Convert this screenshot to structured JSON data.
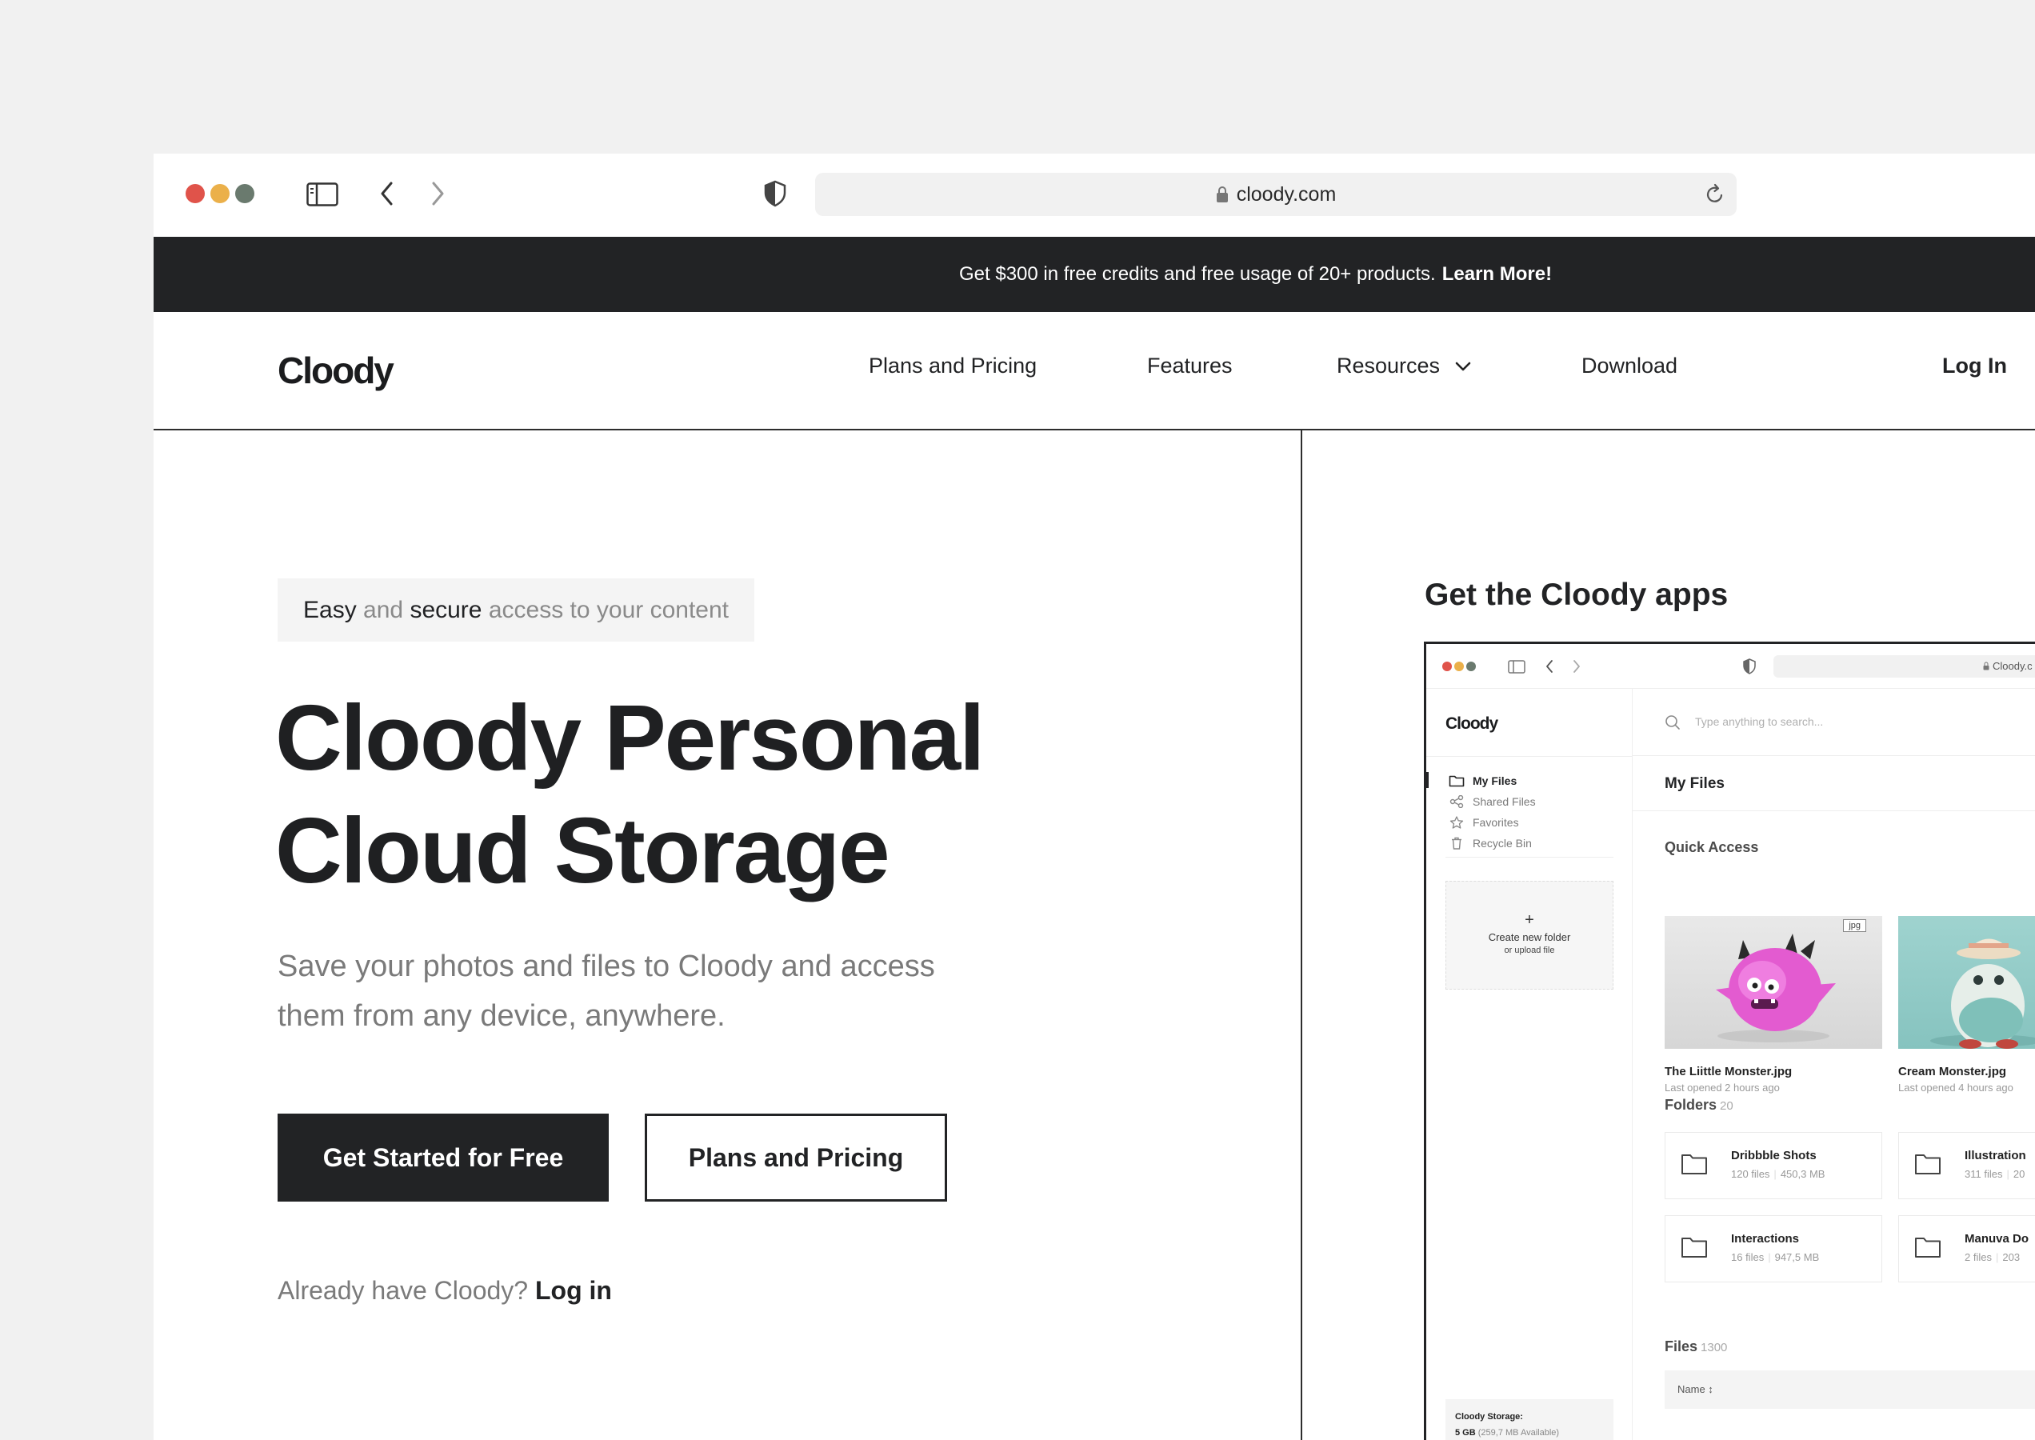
{
  "browser": {
    "url": "cloody.com",
    "traffic_lights": {
      "close": "#e0534a",
      "minimize": "#ebb04a",
      "maximize": "#6a7a6e"
    }
  },
  "promo": {
    "text": "Get $300 in free credits and free usage of 20+ products.",
    "link": "Learn More!"
  },
  "nav": {
    "logo": "Cloody",
    "items": [
      "Plans and Pricing",
      "Features",
      "Resources",
      "Download"
    ],
    "login": "Log In"
  },
  "hero": {
    "tagline": [
      "Easy",
      " and ",
      "secure",
      " access to your content"
    ],
    "title_line1": "Cloody Personal",
    "title_line2": "Cloud Storage",
    "subtitle_line1": "Save your photos and files to Cloody and access",
    "subtitle_line2": "them from any device, anywhere.",
    "primary_button": "Get Started for Free",
    "secondary_button": "Plans and Pricing",
    "already_text": "Already have Cloody?",
    "login_link": "Log in"
  },
  "apps": {
    "title": "Get the Cloody apps",
    "mock": {
      "url": "Cloody.c",
      "logo": "Cloody",
      "search_placeholder": "Type anything to search...",
      "sidebar": [
        {
          "label": "My Files",
          "icon": "folder-icon"
        },
        {
          "label": "Shared Files",
          "icon": "share-icon"
        },
        {
          "label": "Favorites",
          "icon": "star-icon"
        },
        {
          "label": "Recycle Bin",
          "icon": "trash-icon"
        }
      ],
      "create_title": "Create new folder",
      "create_sub": "or upload file",
      "storage_label": "Cloody Storage:",
      "storage_value": "5 GB",
      "storage_available": "(259,7 MB Available)",
      "page_title": "My Files",
      "quick_access": {
        "title": "Quick Access",
        "items": [
          {
            "name": "The Liittle Monster.jpg",
            "meta": "Last opened 2 hours ago",
            "tag": "jpg"
          },
          {
            "name": "Cream Monster.jpg",
            "meta": "Last opened 4 hours ago"
          }
        ]
      },
      "folders": {
        "title": "Folders",
        "count": "20",
        "items": [
          {
            "name": "Dribbble Shots",
            "files": "120 files",
            "size": "450,3 MB"
          },
          {
            "name": "Illustration",
            "files": "311 files",
            "size": "20"
          },
          {
            "name": "Interactions",
            "files": "16 files",
            "size": "947,5 MB"
          },
          {
            "name": "Manuva Do",
            "files": "2 files",
            "size": "203"
          }
        ]
      },
      "files": {
        "title": "Files",
        "count": "1300",
        "column_name": "Name ↕"
      }
    }
  }
}
